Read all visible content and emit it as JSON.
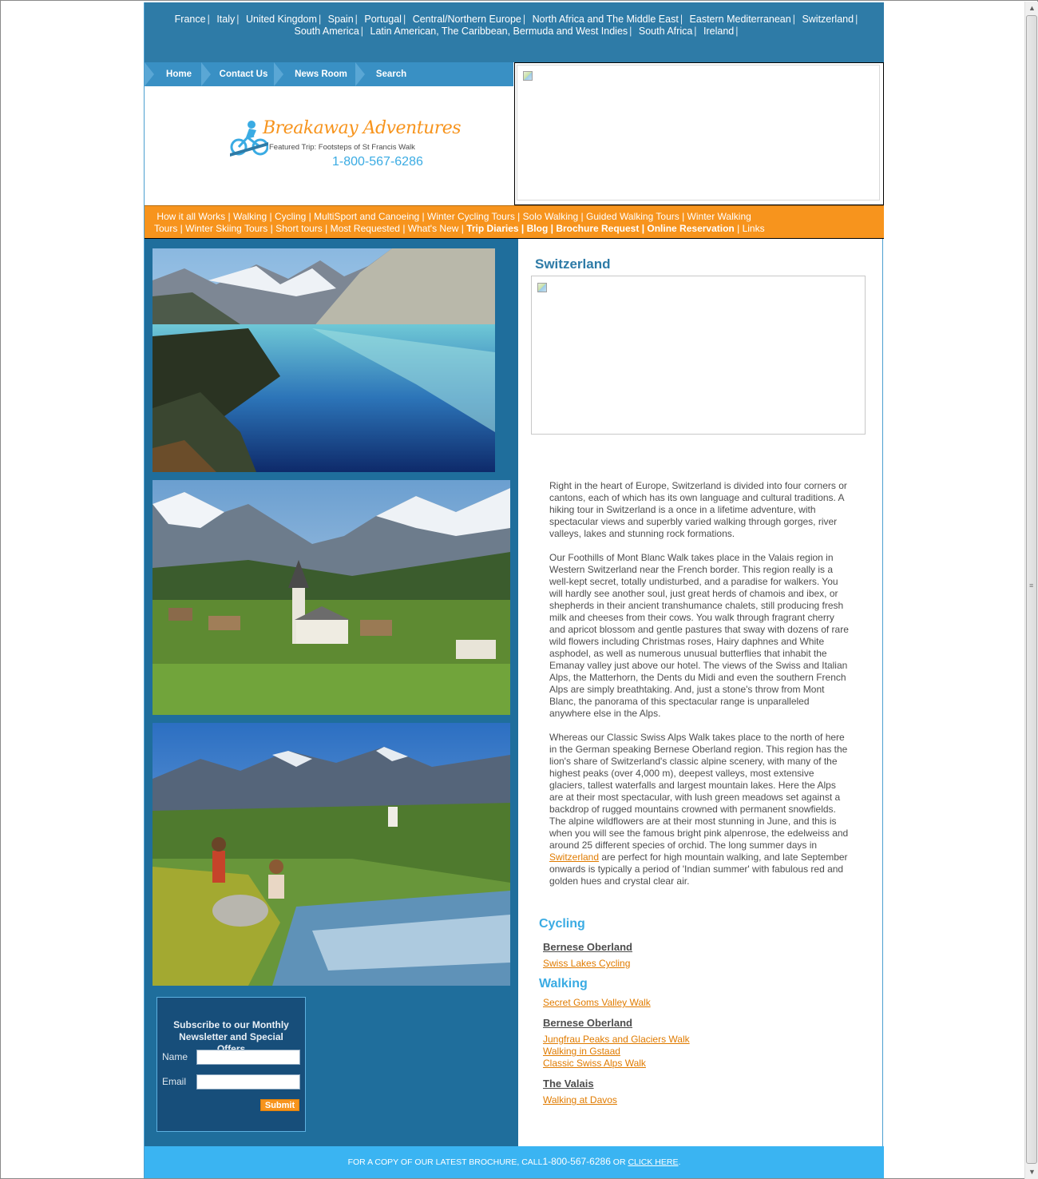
{
  "countries": [
    "France",
    "Italy",
    "United Kingdom",
    "Spain",
    "Portugal",
    "Central/Northern Europe",
    "North Africa and The Middle East",
    "Eastern Mediterranean",
    "Switzerland",
    "South America",
    "Latin American, The Caribbean, Bermuda and West Indies",
    "South Africa",
    "Ireland"
  ],
  "nav": {
    "home": "Home",
    "contact": "Contact Us",
    "news": "News Room",
    "search": "Search"
  },
  "logo": {
    "title": "Breakaway Adventures",
    "featured": "Featured Trip: Footsteps of St Francis Walk",
    "phone": "1-800-567-6286"
  },
  "categories": {
    "regular": [
      "How it all Works",
      "Walking",
      "Cycling",
      "MultiSport and Canoeing",
      "Winter Cycling Tours",
      "Solo Walking",
      "Guided Walking Tours",
      "Winter Walking Tours",
      "Winter Skiing Tours",
      "Short tours",
      "Most Requested",
      "What's New"
    ],
    "bold": [
      "Trip Diaries",
      "Blog",
      "Brochure Request",
      "Online Reservation"
    ],
    "last": "Links"
  },
  "newsletter": {
    "title": "Subscribe to our Monthly Newsletter and Special Offers",
    "name_label": "Name",
    "email_label": "Email",
    "submit": "Submit"
  },
  "content": {
    "title": "Switzerland",
    "p1": "Right in the heart of Europe, Switzerland is divided into four corners or cantons, each of which has its own language and cultural traditions.  A hiking tour in Switzerland is a once in a lifetime adventure, with spectacular views and superbly varied walking through gorges, river valleys, lakes and stunning rock formations.",
    "p2": "Our Foothills of Mont Blanc Walk takes place in the Valais region in Western Switzerland near the French border. This region really is a well-kept secret, totally undisturbed, and a paradise for walkers. You will hardly see another soul, just great herds of chamois and ibex, or shepherds in their ancient transhumance chalets, still producing fresh milk and cheeses from their cows. You walk through fragrant cherry and apricot blossom and gentle pastures that sway with dozens of rare wild flowers including Christmas roses, Hairy daphnes and White asphodel, as well as numerous unusual butterflies that inhabit the Emanay valley just above our hotel. The views of the Swiss and Italian Alps, the Matterhorn, the Dents du Midi and even the southern French Alps are simply breathtaking. And, just a stone's throw from Mont Blanc, the panorama of this spectacular range is unparalleled anywhere else in the Alps.",
    "p3_before": "Whereas our Classic Swiss Alps Walk takes place to the north of here in the German speaking Bernese Oberland region. This region has the lion's share of Switzerland's classic alpine scenery, with many of the highest peaks (over 4,000 m), deepest valleys, most extensive glaciers, tallest waterfalls and largest mountain lakes. Here the Alps are at their most spectacular, with lush green meadows set against a backdrop of rugged mountains crowned with permanent snowfields. The alpine wildflowers are at their most stunning in June, and this is when you will see the famous bright pink alpenrose, the edelweiss and around 25 different species of orchid. The long summer days in ",
    "p3_link": "Switzerland",
    "p3_after": " are perfect for high mountain walking, and late September onwards is typically a period of 'Indian summer' with fabulous red and golden hues and crystal clear air."
  },
  "tours": {
    "cycling_head": "Cycling",
    "cycling_sub": "Bernese Oberland",
    "cycling_link": "Swiss Lakes Cycling",
    "walking_head": "Walking",
    "walking_link1": "Secret Goms Valley Walk",
    "walking_sub1": "Bernese Oberland",
    "walking_link2": "Jungfrau Peaks and Glaciers Walk",
    "walking_link3": "Walking in Gstaad",
    "walking_link4": "Classic Swiss Alps Walk",
    "walking_sub2": "The Valais",
    "walking_link5": "Walking at Davos"
  },
  "footer": {
    "text": "FOR A COPY OF OUR LATEST BROCHURE, CALL",
    "phone": "1-800-567-6286",
    "or": " OR ",
    "click": "CLICK HERE",
    "end": "."
  },
  "colors": {
    "header_blue": "#2e7ba7",
    "nav_blue": "#3990c4",
    "orange": "#f7941d",
    "footer_blue": "#3ab4f2"
  }
}
